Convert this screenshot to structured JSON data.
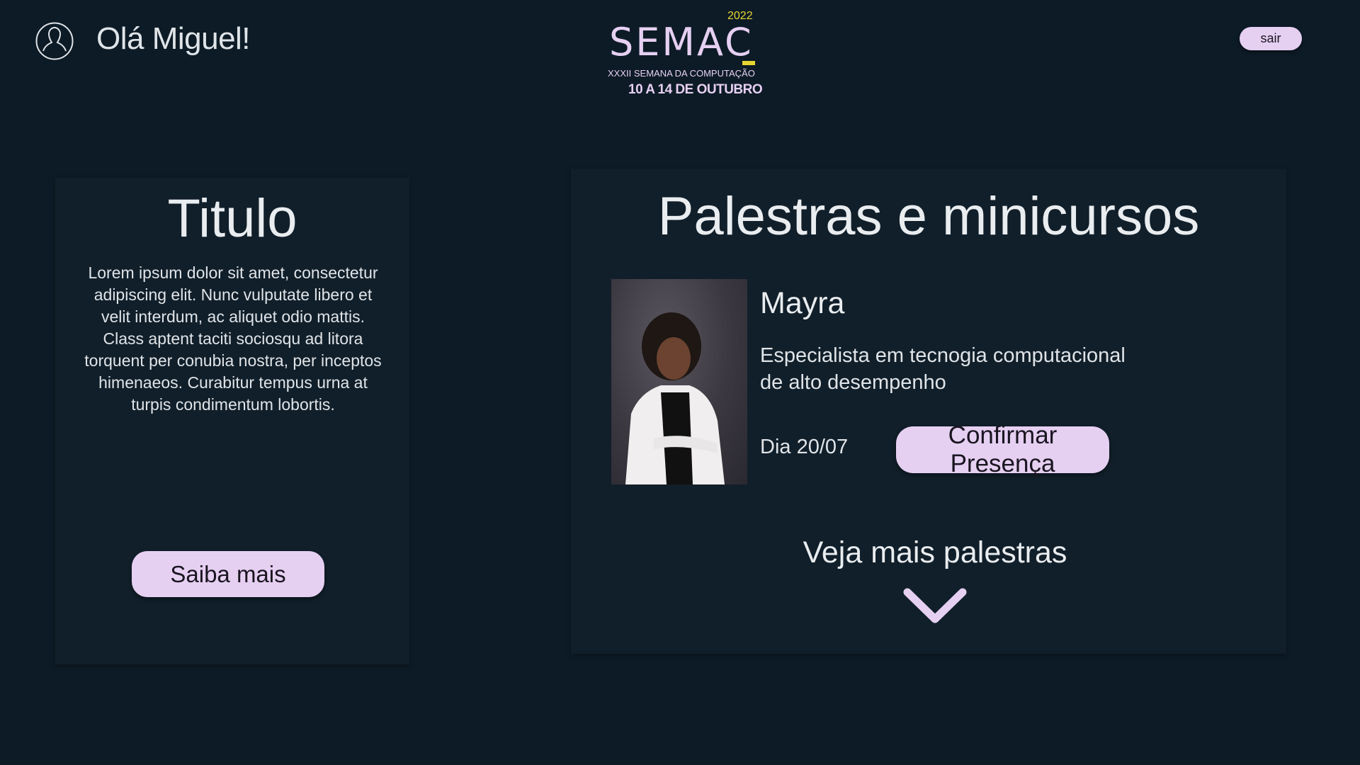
{
  "header": {
    "greeting": "Olá Miguel!",
    "logout_label": "sair",
    "logo": {
      "year": "2022",
      "name": "SEMAC",
      "subtitle": "XXXII SEMANA DA COMPUTAÇÃO",
      "dates": "10 A 14 DE OUTUBRO"
    }
  },
  "info_card": {
    "title": "Titulo",
    "body": "Lorem ipsum dolor sit amet, consectetur adipiscing elit. Nunc vulputate libero et velit interdum, ac aliquet odio mattis. Class aptent taciti sociosqu ad litora torquent per conubia nostra, per inceptos himenaeos. Curabitur tempus urna at turpis condimentum lobortis.",
    "button": "Saiba mais"
  },
  "talks": {
    "title": "Palestras e minicursos",
    "speaker": {
      "name": "Mayra",
      "description": "Especialista em tecnogia computacional de alto desempenho",
      "date": "Dia 20/07",
      "button": "Confirmar Presença"
    },
    "more_label": "Veja mais palestras"
  },
  "colors": {
    "background": "#0d1b26",
    "panel": "#111f2a",
    "accent": "#e6d0f2",
    "logo_yellow": "#e8d630"
  }
}
